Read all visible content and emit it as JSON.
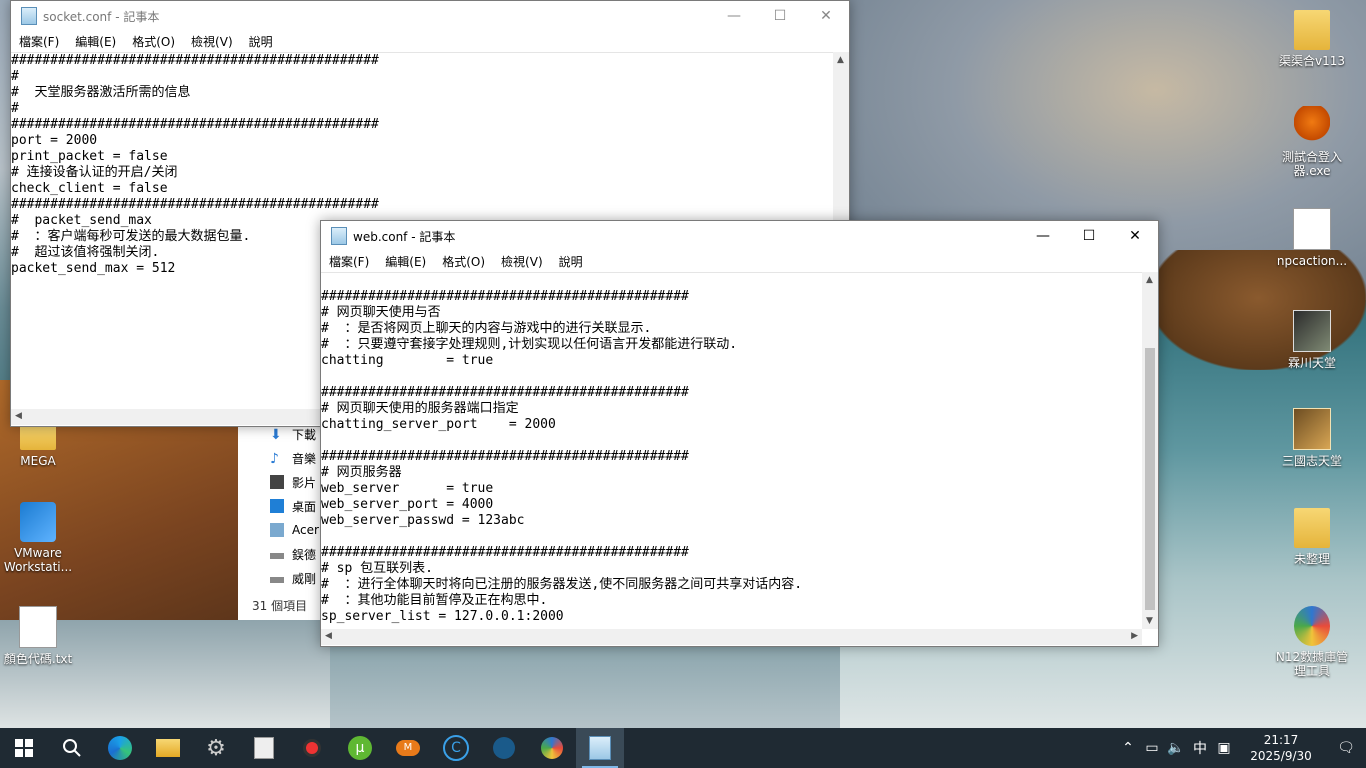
{
  "desktop_icons_right": [
    {
      "label": "渠渠合v113",
      "glyph": "glyph-folder"
    },
    {
      "label": "測試合登入器.exe",
      "glyph": "glyph-mush"
    },
    {
      "label": "npcaction...",
      "glyph": "glyph-doc"
    },
    {
      "label": "霖川天堂",
      "glyph": "glyph-dark"
    },
    {
      "label": "三國志天堂",
      "glyph": "glyph-game"
    },
    {
      "label": "未整理",
      "glyph": "glyph-folder"
    },
    {
      "label": "N12數據庫管理工具",
      "glyph": "glyph-multi"
    }
  ],
  "desktop_icons_left": [
    {
      "label": "MEGA",
      "glyph": "glyph-folder"
    },
    {
      "label": "VMware Workstati...",
      "glyph": "glyph-app"
    },
    {
      "label": "顏色代碼.txt",
      "glyph": "glyph-doc"
    }
  ],
  "menu": [
    "檔案(F)",
    "編輯(E)",
    "格式(O)",
    "檢視(V)",
    "說明"
  ],
  "window_buttons": {
    "minimize": "—",
    "maximize": "☐",
    "close": "✕"
  },
  "socket_window": {
    "title": "socket.conf - 記事本",
    "lines": [
      "###############################################",
      "#",
      "#  天堂服务器激活所需的信息",
      "#",
      "###############################################",
      "port = 2000",
      "print_packet = false",
      "# 连接设备认证的开启/关闭",
      "check_client = false",
      "###############################################",
      "#  packet_send_max",
      "#  ：客户端每秒可发送的最大数据包量.",
      "#  超过该值将强制关闭.",
      "packet_send_max = 512"
    ]
  },
  "web_window": {
    "title": "web.conf - 記事本",
    "lines": [
      "",
      "###############################################",
      "# 网页聊天使用与否",
      "#  ：是否将网页上聊天的内容与游戏中的进行关联显示.",
      "#  ：只要遵守套接字处理规则,计划实现以任何语言开发都能进行联动.",
      "chatting        = true",
      "",
      "###############################################",
      "# 网页聊天使用的服务器端口指定",
      "chatting_server_port    = 2000",
      "",
      "###############################################",
      "# 网页服务器",
      "web_server      = true",
      "web_server_port = 4000",
      "web_server_passwd = 123abc",
      "",
      "###############################################",
      "# sp 包互联列表.",
      "#  ：进行全体聊天时将向已注册的服务器发送,使不同服务器之间可共享对话内容.",
      "#  ：其他功能目前暂停及正在构思中.",
      "sp_server_list = 127.0.0.1:2000"
    ]
  },
  "explorer": {
    "items": [
      "下載",
      "音樂",
      "影片",
      "桌面",
      "Acer",
      "鋘德",
      "威剛"
    ],
    "status": "31 個項目"
  },
  "taskbar": {
    "apps": [
      "search-icon",
      "edge-icon",
      "file-explorer-icon",
      "settings-icon",
      "notepad-alt-icon",
      "record-icon",
      "utorrent-icon",
      "mega-icon",
      "ccleaner-icon",
      "dots-app-icon",
      "color-app-icon",
      "notepad-icon"
    ],
    "ime": "中",
    "time": "21:17",
    "date": "2025/9/30"
  }
}
